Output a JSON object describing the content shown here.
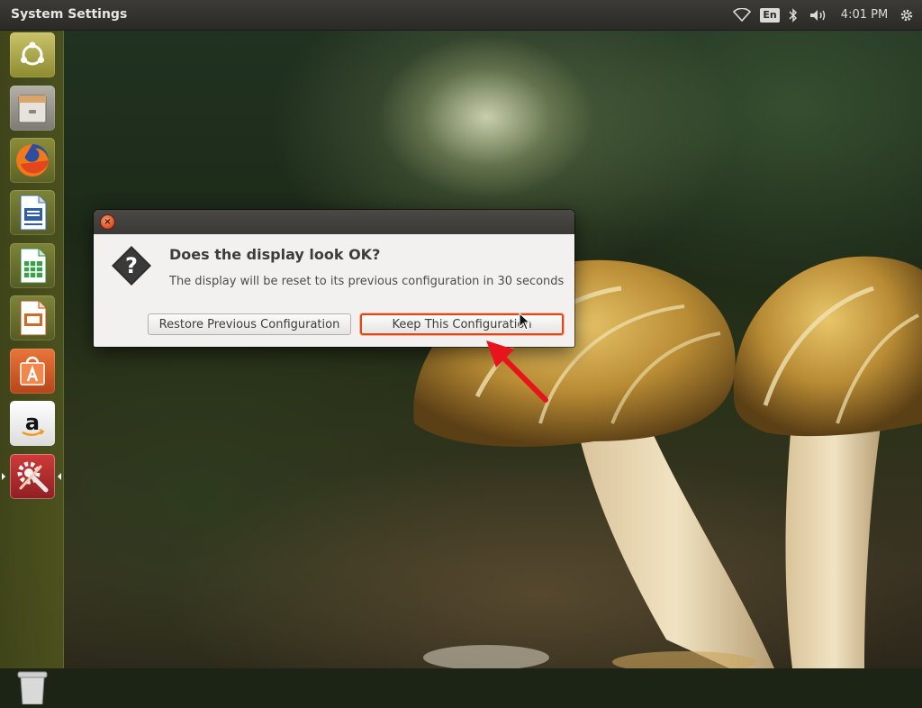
{
  "top_panel": {
    "app_title": "System Settings",
    "keyboard_layout": "En",
    "clock": "4:01 PM",
    "icons": [
      "wifi-icon",
      "keyboard-layout-indicator",
      "bluetooth-icon",
      "volume-icon",
      "session-gear-icon"
    ]
  },
  "launcher": {
    "items": [
      {
        "name": "Dash Home",
        "icon": "ubuntu-logo-icon"
      },
      {
        "name": "Files",
        "icon": "file-cabinet-icon"
      },
      {
        "name": "Firefox Web Browser",
        "icon": "firefox-icon"
      },
      {
        "name": "LibreOffice Writer",
        "icon": "writer-icon"
      },
      {
        "name": "LibreOffice Calc",
        "icon": "calc-icon"
      },
      {
        "name": "LibreOffice Impress",
        "icon": "impress-icon"
      },
      {
        "name": "Ubuntu Software Center",
        "icon": "software-center-icon"
      },
      {
        "name": "Amazon",
        "icon": "amazon-icon"
      },
      {
        "name": "System Settings",
        "icon": "system-settings-icon",
        "active": true
      },
      {
        "name": "Trash",
        "icon": "trash-icon"
      }
    ]
  },
  "dialog": {
    "heading": "Does the display look OK?",
    "message": "The display will be reset to its previous configuration in 30 seconds",
    "restore_label": "Restore Previous Configuration",
    "keep_label": "Keep This Configuration",
    "close_glyph": "×"
  },
  "colors": {
    "accent": "#dd4814",
    "panel": "#3c3b37",
    "annotation_arrow": "#e8141c"
  }
}
